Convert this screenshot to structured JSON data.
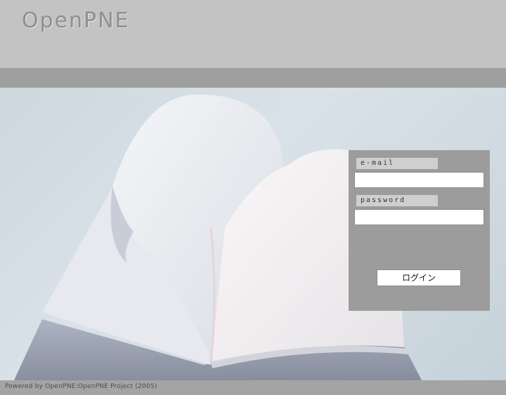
{
  "header": {
    "logo_text": "OpenPNE"
  },
  "login": {
    "email_label": "e-mail",
    "email_value": "",
    "password_label": "password",
    "password_value": "",
    "login_button": "ログイン"
  },
  "footer": {
    "text": "Powered by OpenPNE:OpenPNE Project (2005)"
  },
  "colors": {
    "header_bg": "#c3c3c3",
    "band_bg": "#9f9f9f",
    "panel_bg": "#9c9c9c",
    "footer_bg": "#a4a4a4"
  }
}
